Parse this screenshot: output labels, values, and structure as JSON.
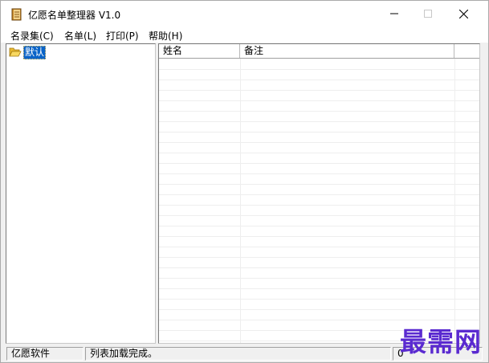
{
  "window": {
    "title": "亿愿名单整理器 V1.0",
    "icons": {
      "app": "book-icon",
      "minimize": "minimize-icon",
      "maximize": "maximize-icon",
      "close": "close-icon"
    }
  },
  "menu": {
    "items": [
      {
        "label": "名录集(C)"
      },
      {
        "label": "名单(L)"
      },
      {
        "label": "打印(P)"
      },
      {
        "label": "帮助(H)"
      }
    ]
  },
  "tree": {
    "nodes": [
      {
        "label": "默认",
        "icon": "open-folder-icon",
        "selected": true
      }
    ]
  },
  "list": {
    "columns": [
      {
        "label": "姓名"
      },
      {
        "label": "备注"
      },
      {
        "label": ""
      }
    ],
    "rows": []
  },
  "status": {
    "company": "亿愿软件",
    "message": "列表加载完成。",
    "count": "0"
  },
  "watermark": {
    "text": "最需网"
  },
  "colors": {
    "selection": "#0a64c8",
    "watermark": "#5a2ad0",
    "chrome": "#f0f0f0"
  }
}
